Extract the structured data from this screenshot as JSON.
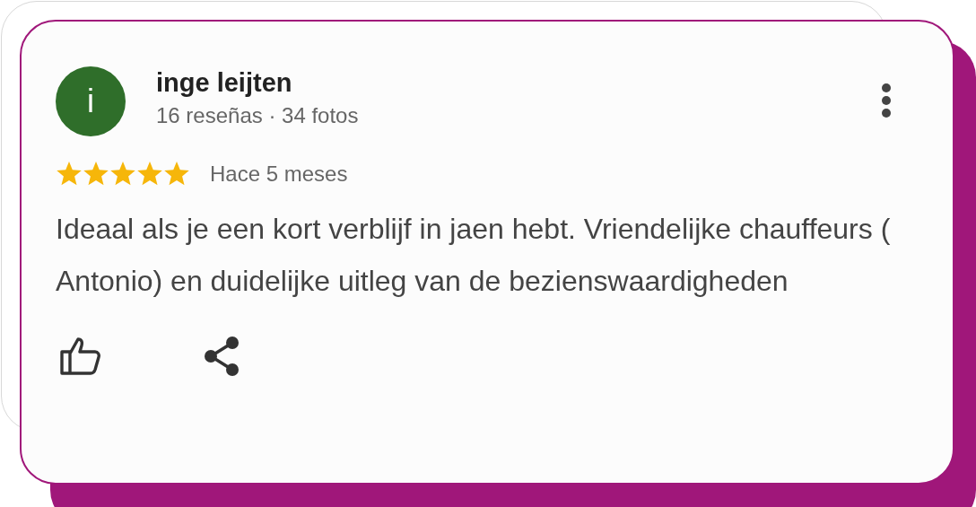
{
  "review": {
    "author": "inge leijten",
    "avatar_letter": "i",
    "meta": "16 reseñas · 34 fotos",
    "stars": 5,
    "time": "Hace 5 meses",
    "text": "Ideaal als je een kort verblijf in jaen hebt. Vriendelijke chauffeurs ( Antonio) en duidelijke uitleg van de bezienswaardigheden"
  }
}
